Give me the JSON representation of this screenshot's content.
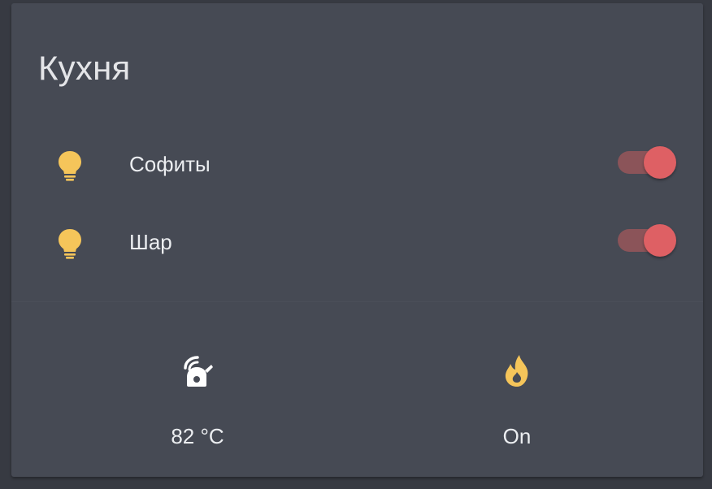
{
  "card": {
    "title": "Кухня"
  },
  "entities": [
    {
      "label": "Софиты",
      "icon": "lightbulb-icon",
      "state": "on"
    },
    {
      "label": "Шар",
      "icon": "lightbulb-icon",
      "state": "on"
    }
  ],
  "stats": [
    {
      "icon": "kettle-icon",
      "value": "82 °C"
    },
    {
      "icon": "flame-icon",
      "value": "On"
    }
  ],
  "colors": {
    "page_background": "#373a42",
    "card_background": "#464a54",
    "bulb_active": "#f5c55a",
    "toggle_on": "#de6064",
    "toggle_track_on": "#8b5459",
    "text_primary": "#eceef1"
  }
}
